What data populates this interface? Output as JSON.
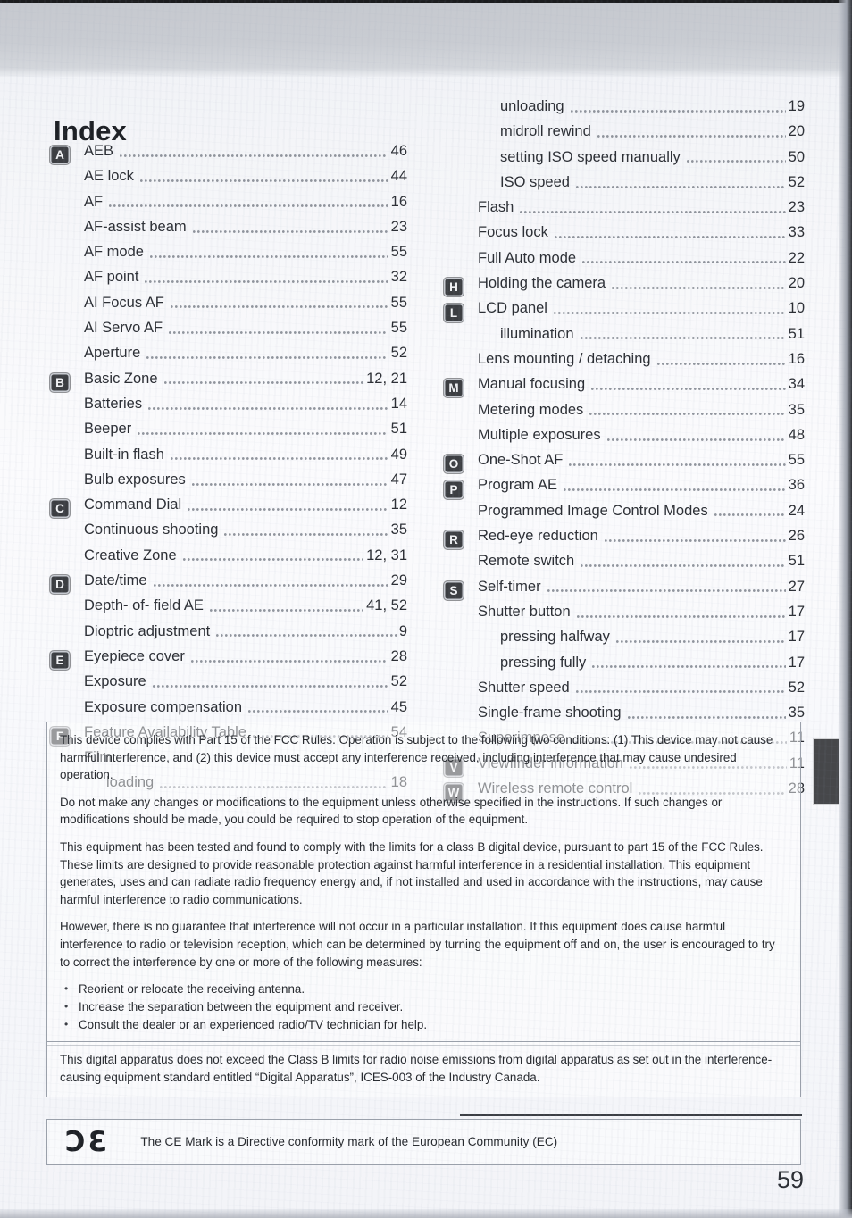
{
  "page": {
    "title": "Index",
    "page_number": "59"
  },
  "index": {
    "left_column": [
      {
        "badge": "A",
        "label": "AEB",
        "page": "46",
        "sub": false
      },
      {
        "badge": "",
        "label": "AE lock",
        "page": "44",
        "sub": false
      },
      {
        "badge": "",
        "label": "AF",
        "page": "16",
        "sub": false
      },
      {
        "badge": "",
        "label": "AF-assist beam",
        "page": "23",
        "sub": false
      },
      {
        "badge": "",
        "label": "AF mode",
        "page": "55",
        "sub": false
      },
      {
        "badge": "",
        "label": "AF point",
        "page": "32",
        "sub": false
      },
      {
        "badge": "",
        "label": "AI Focus AF",
        "page": "55",
        "sub": false
      },
      {
        "badge": "",
        "label": "AI Servo AF",
        "page": "55",
        "sub": false
      },
      {
        "badge": "",
        "label": "Aperture",
        "page": "52",
        "sub": false
      },
      {
        "badge": "B",
        "label": "Basic Zone",
        "page": "12, 21",
        "sub": false
      },
      {
        "badge": "",
        "label": "Batteries",
        "page": "14",
        "sub": false
      },
      {
        "badge": "",
        "label": "Beeper",
        "page": "51",
        "sub": false
      },
      {
        "badge": "",
        "label": "Built-in flash",
        "page": "49",
        "sub": false
      },
      {
        "badge": "",
        "label": "Bulb exposures",
        "page": "47",
        "sub": false
      },
      {
        "badge": "C",
        "label": "Command Dial",
        "page": "12",
        "sub": false
      },
      {
        "badge": "",
        "label": "Continuous shooting",
        "page": "35",
        "sub": false
      },
      {
        "badge": "",
        "label": "Creative Zone",
        "page": "12, 31",
        "sub": false
      },
      {
        "badge": "D",
        "label": "Date/time",
        "page": "29",
        "sub": false
      },
      {
        "badge": "",
        "label": "Depth- of- field AE",
        "page": "41, 52",
        "sub": false
      },
      {
        "badge": "",
        "label": "Dioptric adjustment",
        "page": "9",
        "sub": false
      },
      {
        "badge": "E",
        "label": "Eyepiece cover",
        "page": "28",
        "sub": false
      },
      {
        "badge": "",
        "label": "Exposure",
        "page": "52",
        "sub": false
      },
      {
        "badge": "",
        "label": "Exposure compensation",
        "page": "45",
        "sub": false
      },
      {
        "badge": "F",
        "label": "Feature Availability Table",
        "page": "54",
        "sub": false
      },
      {
        "badge": "",
        "label": "Film",
        "page": "",
        "sub": false
      },
      {
        "badge": "",
        "label": "loading",
        "page": "18",
        "sub": true
      }
    ],
    "right_column": [
      {
        "badge": "",
        "label": "unloading",
        "page": "19",
        "sub": true
      },
      {
        "badge": "",
        "label": "midroll rewind",
        "page": "20",
        "sub": true
      },
      {
        "badge": "",
        "label": "setting ISO speed manually",
        "page": "50",
        "sub": true
      },
      {
        "badge": "",
        "label": "ISO speed",
        "page": "52",
        "sub": true
      },
      {
        "badge": "",
        "label": "Flash",
        "page": "23",
        "sub": false
      },
      {
        "badge": "",
        "label": "Focus lock",
        "page": "33",
        "sub": false
      },
      {
        "badge": "",
        "label": "Full Auto mode",
        "page": "22",
        "sub": false
      },
      {
        "badge": "H",
        "label": "Holding the camera",
        "page": "20",
        "sub": false
      },
      {
        "badge": "L",
        "label": "LCD panel",
        "page": "10",
        "sub": false
      },
      {
        "badge": "",
        "label": "illumination",
        "page": "51",
        "sub": true
      },
      {
        "badge": "",
        "label": "Lens mounting / detaching",
        "page": "16",
        "sub": false
      },
      {
        "badge": "M",
        "label": "Manual focusing",
        "page": "34",
        "sub": false
      },
      {
        "badge": "",
        "label": "Metering modes",
        "page": "35",
        "sub": false
      },
      {
        "badge": "",
        "label": "Multiple exposures",
        "page": "48",
        "sub": false
      },
      {
        "badge": "O",
        "label": "One-Shot AF",
        "page": "55",
        "sub": false
      },
      {
        "badge": "P",
        "label": "Program AE",
        "page": "36",
        "sub": false
      },
      {
        "badge": "",
        "label": "Programmed Image Control Modes",
        "page": "24",
        "sub": false
      },
      {
        "badge": "R",
        "label": "Red-eye reduction",
        "page": "26",
        "sub": false
      },
      {
        "badge": "",
        "label": "Remote switch",
        "page": "51",
        "sub": false
      },
      {
        "badge": "S",
        "label": "Self-timer",
        "page": "27",
        "sub": false
      },
      {
        "badge": "",
        "label": "Shutter button",
        "page": "17",
        "sub": false
      },
      {
        "badge": "",
        "label": "pressing halfway",
        "page": "17",
        "sub": true
      },
      {
        "badge": "",
        "label": "pressing fully",
        "page": "17",
        "sub": true
      },
      {
        "badge": "",
        "label": "Shutter speed",
        "page": "52",
        "sub": false
      },
      {
        "badge": "",
        "label": "Single-frame shooting",
        "page": "35",
        "sub": false
      },
      {
        "badge": "",
        "label": "Superimpose",
        "page": "11",
        "sub": false
      },
      {
        "badge": "V",
        "label": "Viewfinder information",
        "page": "11",
        "sub": false
      },
      {
        "badge": "W",
        "label": "Wireless remote control",
        "page": "28",
        "sub": false
      }
    ]
  },
  "notices": {
    "fcc": {
      "paragraphs": [
        "This device complies with Part 15 of the FCC Rules. Operation is subject to the following two conditions: (1) This device may not cause harmful interference, and (2) this device must accept any interference received, including interference that may cause undesired operation.",
        "Do not make any changes or modifications to the equipment unless otherwise specified in the instructions. If such changes or modifications should be made, you could be required to stop operation of the equipment.",
        "This equipment has been tested and found to comply with the limits for a class B digital device, pursuant to part 15 of the FCC Rules. These limits are designed to provide reasonable protection against harmful interference in a residential installation. This equipment generates, uses and can radiate radio frequency energy and, if not installed and used in accordance with the instructions, may cause harmful interference to radio communications.",
        "However, there is no guarantee that interference will not occur in a particular installation. If this equipment does cause harmful interference to radio or television reception, which can be determined by turning the equipment off and on, the user is encouraged to try to correct the interference by one or more of the following measures:"
      ],
      "bullets": [
        "Reorient or relocate the receiving antenna.",
        "Increase the separation between the equipment and receiver.",
        "Consult the dealer or an experienced radio/TV technician for help."
      ]
    },
    "ices": {
      "text": "This digital apparatus does not exceed the Class B limits for radio noise emissions from digital apparatus as set out in the interference-causing equipment standard entitled “Digital Apparatus”, ICES-003 of the Industry Canada."
    },
    "ce": {
      "mark": "ƆƐ",
      "text": "The CE Mark is a Directive conformity mark of the European Community (EC)"
    }
  }
}
